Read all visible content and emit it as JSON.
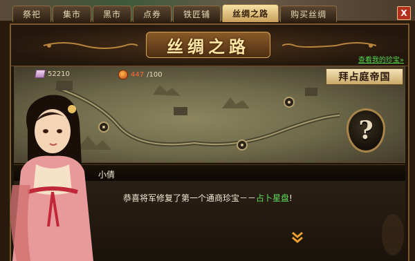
{
  "tabs": [
    {
      "label": "祭祀",
      "active": false
    },
    {
      "label": "集市",
      "active": false
    },
    {
      "label": "黑市",
      "active": false
    },
    {
      "label": "点券",
      "active": false
    },
    {
      "label": "铁匠铺",
      "active": false
    },
    {
      "label": "丝绸之路",
      "active": true
    },
    {
      "label": "购买丝绸",
      "active": false
    }
  ],
  "close_label": "X",
  "title": "丝绸之路",
  "view_treasure_link": "查看我的珍宝»",
  "stats": {
    "coins": "52210",
    "food_current": "447",
    "food_max": "/100"
  },
  "region_name": "拜占庭帝国",
  "help_glyph": "?",
  "dialog": {
    "speaker": "小倩",
    "message_prefix": "恭喜将军修复了第一个通商珍宝－－",
    "message_highlight": "占卜星盘",
    "message_suffix": "!"
  },
  "icons": {
    "coins": "silk-coin-icon",
    "food": "money-bag-icon",
    "next": "double-chevron-down-icon",
    "help": "question-mark-icon"
  },
  "colors": {
    "accent_gold": "#d6a458",
    "highlight_green": "#5ee05a",
    "alert_red": "#ff6a3a"
  }
}
